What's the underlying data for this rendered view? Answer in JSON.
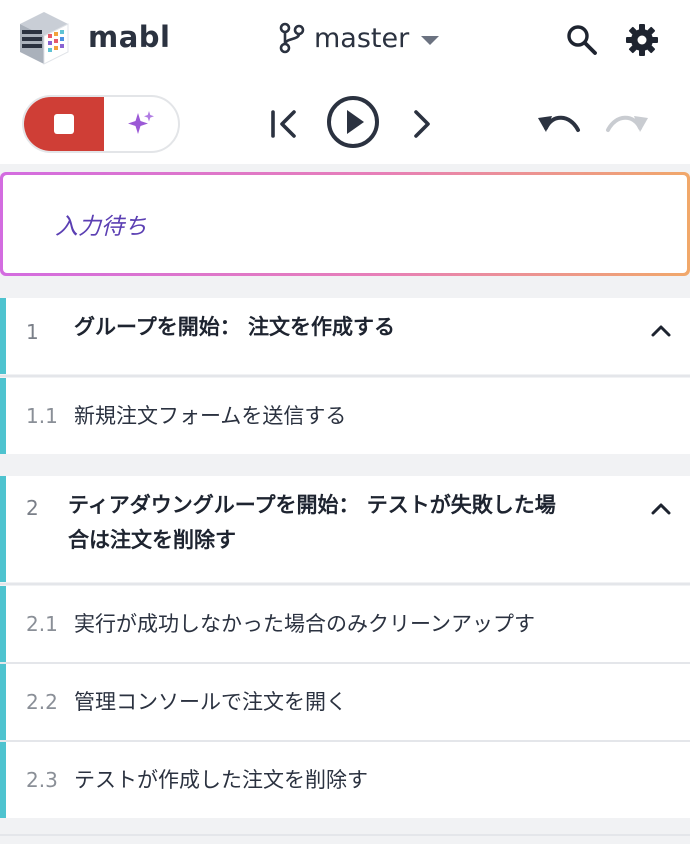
{
  "header": {
    "brand": "mabl",
    "branch": "master",
    "icons": {
      "logo": "mabl-logo-icon",
      "branch": "git-branch-icon",
      "search": "search-icon",
      "settings": "gear-icon"
    }
  },
  "toolbar": {
    "icons": {
      "stop": "stop-icon",
      "ai": "sparkle-icon",
      "restart": "skip-to-start-icon",
      "play": "play-icon",
      "next": "chevron-right-icon",
      "undo": "undo-icon",
      "redo": "redo-icon"
    },
    "colors": {
      "stop": "#cf3e36",
      "ai": "#9b59d6",
      "redo_disabled": "#c9ccd1"
    }
  },
  "status": {
    "text": "入力待ち"
  },
  "groups": [
    {
      "number": "1",
      "title": "グループを開始：  注文を作成する",
      "steps": [
        {
          "number": "1.1",
          "title": "新規注文フォームを送信する"
        }
      ]
    },
    {
      "number": "2",
      "title_line1": "ティアダウングループを開始：  テストが失敗した場",
      "title_line2": "合は注文を削除す",
      "steps": [
        {
          "number": "2.1",
          "title": "実行が成功しなかった場合のみクリーンアップす"
        },
        {
          "number": "2.2",
          "title": "管理コンソールで注文を開く"
        },
        {
          "number": "2.3",
          "title": "テストが作成した注文を削除す"
        }
      ]
    }
  ],
  "colors": {
    "accent": "#4ec3cf",
    "status_text": "#5b3fb3"
  }
}
